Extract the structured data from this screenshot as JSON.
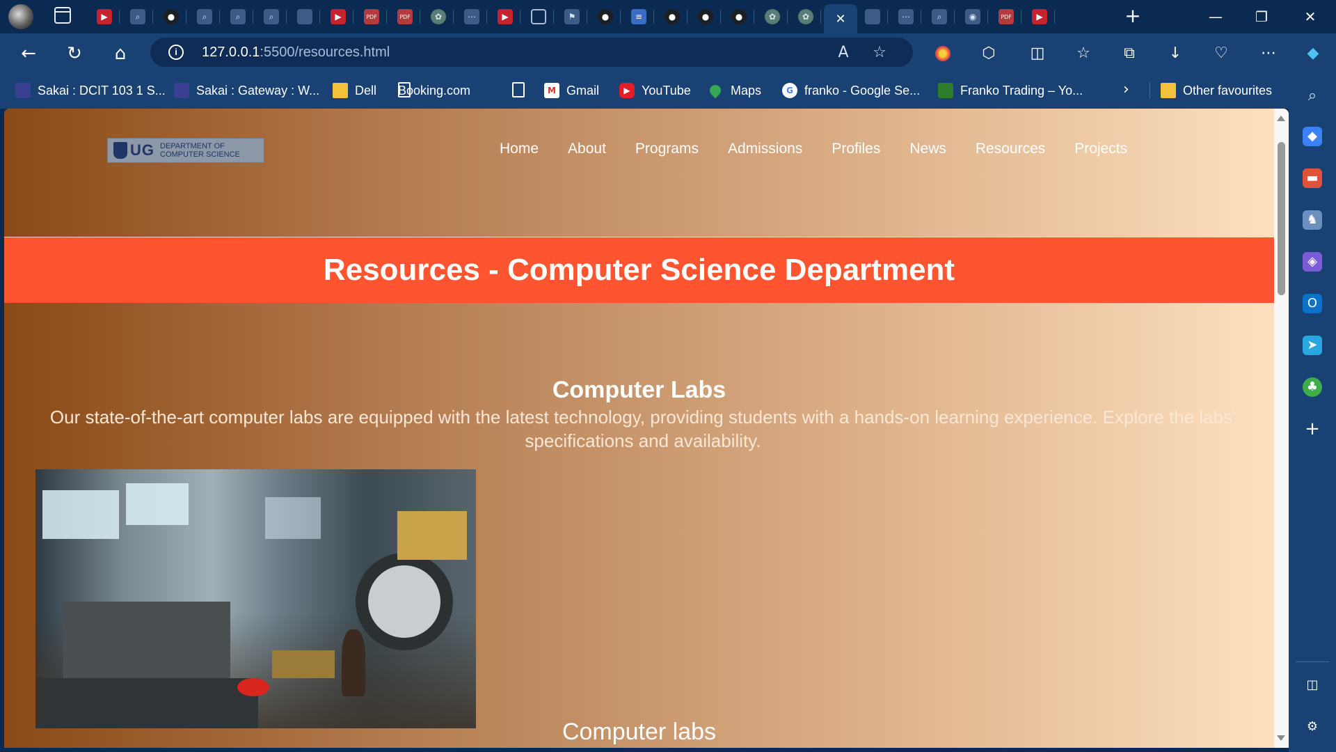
{
  "browser": {
    "url_host": "127.0.0.1",
    "url_path": ":5500/resources.html",
    "tab_icons": [
      "youtube-icon",
      "search-icon",
      "github-icon",
      "search-icon",
      "search-icon",
      "search-icon",
      "sakai-icon",
      "youtube-icon",
      "pdf-icon",
      "pdf-icon",
      "chatgpt-icon",
      "more-icon",
      "youtube-icon",
      "document-icon",
      "flag-icon",
      "github-icon",
      "notes-icon",
      "github-icon",
      "github-icon",
      "github-icon",
      "chatgpt-icon",
      "chatgpt-icon",
      "sakai-icon",
      "more-icon",
      "search-icon",
      "maps-icon",
      "pdf-icon",
      "youtube-icon"
    ],
    "bookmarks": [
      {
        "label": "Sakai : DCIT 103 1 S...",
        "icon": "sakai-icon"
      },
      {
        "label": "Sakai : Gateway : W...",
        "icon": "sakai-icon"
      },
      {
        "label": "Dell",
        "icon": "folder-icon"
      },
      {
        "label": "Booking.com",
        "icon": "page-icon"
      },
      {
        "label": "",
        "icon": "page-icon"
      },
      {
        "label": "Gmail",
        "icon": "gmail-icon"
      },
      {
        "label": "YouTube",
        "icon": "youtube-icon"
      },
      {
        "label": "Maps",
        "icon": "maps-icon"
      },
      {
        "label": "franko - Google Se...",
        "icon": "google-icon"
      },
      {
        "label": "Franko Trading – Yo...",
        "icon": "franko-icon"
      }
    ],
    "other_favourites": "Other favourites"
  },
  "site": {
    "logo_ug": "UG",
    "logo_dept_line1": "DEPARTMENT OF",
    "logo_dept_line2": "COMPUTER SCIENCE",
    "nav": [
      "Home",
      "About",
      "Programs",
      "Admissions",
      "Profiles",
      "News",
      "Resources",
      "Projects"
    ],
    "hero_title": "Resources - Computer Science Department",
    "section_title": "Computer Labs",
    "section_text": "Our state-of-the-art computer labs are equipped with the latest technology, providing students with a hands-on learning experience. Explore the labs' specifications and availability.",
    "image_caption": "Computer labs"
  },
  "colors": {
    "browser_frame": "#0b2a52",
    "toolbar": "#1a4173",
    "hero_banner": "#fe5430",
    "gradient_start": "#8a4a17",
    "gradient_end": "#fde0bf"
  }
}
